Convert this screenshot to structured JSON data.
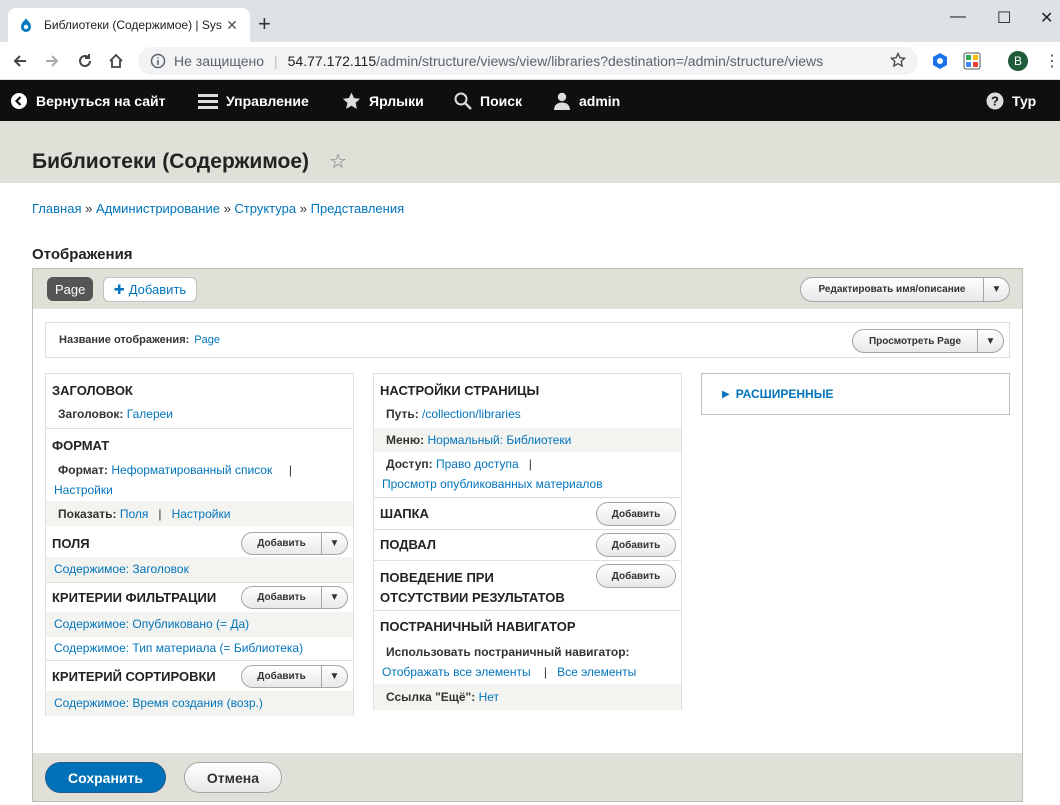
{
  "browser": {
    "tab_title": "Библиотеки (Содержимое) | Sys",
    "new_tab": "+",
    "not_secure": "Не защищено",
    "url_host": "54.77.172.115",
    "url_path": "/admin/structure/views/view/libraries?destination=/admin/structure/views",
    "profile_initial": "B"
  },
  "toolbar": {
    "back_to_site": "Вернуться на сайт",
    "manage": "Управление",
    "shortcuts": "Ярлыки",
    "search": "Поиск",
    "user": "admin",
    "tour": "Тур"
  },
  "page": {
    "title": "Библиотеки (Содержимое)",
    "breadcrumb": [
      "Главная",
      "Администрирование",
      "Структура",
      "Представления"
    ],
    "breadcrumb_sep": "»",
    "displays_heading": "Отображения"
  },
  "display_tabs": {
    "active": "Page",
    "add": "Добавить",
    "edit_name_btn": "Редактировать имя/описание"
  },
  "display_name": {
    "label": "Название отображения:",
    "value": "Page",
    "preview_btn": "Просмотреть Page"
  },
  "left": {
    "title_section": "ЗАГОЛОВОК",
    "title_label": "Заголовок:",
    "title_value": "Галереи",
    "format_section": "ФОРМАТ",
    "format_label": "Формат:",
    "format_value": "Неформатированный список",
    "format_sep": "|",
    "format_settings": "Настройки",
    "show_label": "Показать:",
    "show_value": "Поля",
    "show_sep": "|",
    "show_settings": "Настройки",
    "fields_section": "ПОЛЯ",
    "fields_add": "Добавить",
    "field_1": "Содержимое: Заголовок",
    "filters_section": "КРИТЕРИИ ФИЛЬТРАЦИИ",
    "filters_add": "Добавить",
    "filter_1": "Содержимое: Опубликовано (= Да)",
    "filter_2": "Содержимое: Тип материала (= Библиотека)",
    "sort_section": "КРИТЕРИЙ СОРТИРОВКИ",
    "sort_add": "Добавить",
    "sort_1": "Содержимое: Время создания (возр.)"
  },
  "middle": {
    "page_settings": "НАСТРОЙКИ СТРАНИЦЫ",
    "path_label": "Путь:",
    "path_value": "/collection/libraries",
    "menu_label": "Меню:",
    "menu_value": "Нормальный: Библиотеки",
    "access_label": "Доступ:",
    "access_value": "Право доступа",
    "access_sep": "|",
    "access_perm": "Просмотр опубликованных материалов",
    "header_section": "ШАПКА",
    "header_add": "Добавить",
    "footer_section": "ПОДВАЛ",
    "footer_add": "Добавить",
    "no_results_section": "ПОВЕДЕНИЕ ПРИ ОТСУТСТВИИ РЕЗУЛЬТАТОВ",
    "no_results_add": "Добавить",
    "pager_section": "ПОСТРАНИЧНЫЙ НАВИГАТОР",
    "pager_use_label": "Использовать постраничный навигатор:",
    "pager_value": "Отображать все элементы",
    "pager_sep": "|",
    "pager_all": "Все элементы",
    "more_label": "Ссылка \"Ещё\":",
    "more_value": "Нет"
  },
  "right": {
    "advanced": "РАСШИРЕННЫЕ"
  },
  "actions": {
    "save": "Сохранить",
    "cancel": "Отмена"
  }
}
